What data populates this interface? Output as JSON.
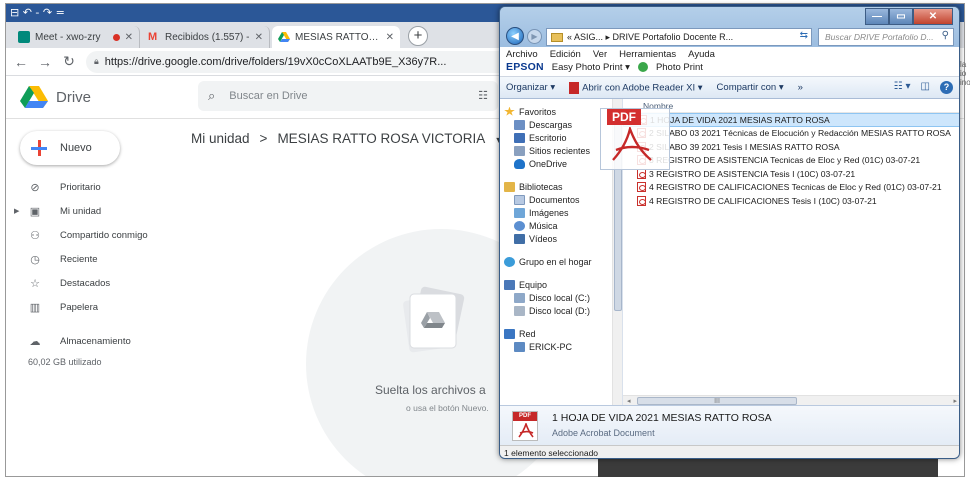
{
  "titlebar": {
    "quick_icons": "⊟ ↶ - ↷ ="
  },
  "browser": {
    "tabs": [
      {
        "label": "Meet - xwo-zry",
        "favicon_color": "#00897b"
      },
      {
        "label": "Recibidos (1.557) -",
        "favicon_color": "#ea4335"
      },
      {
        "label": "MESIAS RATTO ROS",
        "favicon_color": "#fbbc04"
      }
    ],
    "new_tab": "+",
    "url": "https://drive.google.com/drive/folders/19vX0cCoXLAATb9E_X36y7R..."
  },
  "drive": {
    "app_name": "Drive",
    "search_placeholder": "Buscar en Drive",
    "new_button": "Nuevo",
    "nav": [
      {
        "label": "Prioritario",
        "icon": "check-circle-icon"
      },
      {
        "label": "Mi unidad",
        "icon": "drive-icon"
      },
      {
        "label": "Compartido conmigo",
        "icon": "people-icon"
      },
      {
        "label": "Reciente",
        "icon": "clock-icon"
      },
      {
        "label": "Destacados",
        "icon": "star-icon"
      },
      {
        "label": "Papelera",
        "icon": "trash-icon"
      },
      {
        "label": "Almacenamiento",
        "icon": "cloud-icon"
      }
    ],
    "storage_used": "60,02 GB utilizado",
    "breadcrumb": {
      "root": "Mi unidad",
      "separator": ">",
      "current": "MESIAS RATTO ROSA VICTORIA",
      "dropdown": "▾"
    },
    "drop_title": "Suelta los archivos a",
    "drop_sub": "o usa el botón Nuevo."
  },
  "explorer": {
    "address": "« ASIG... ▸ DRIVE Portafolio Docente R...",
    "search_placeholder": "Buscar DRIVE Portafolio D...",
    "menu": [
      "Archivo",
      "Edición",
      "Ver",
      "Herramientas",
      "Ayuda"
    ],
    "epson": {
      "brand": "EPSON",
      "easy": "Easy Photo Print ▾",
      "photo": "Photo Print"
    },
    "commands": {
      "organize": "Organizar ▾",
      "open_with": "Abrir con Adobe Reader XI ▾",
      "share": "Compartir con ▾",
      "more": "»"
    },
    "nav_groups": [
      {
        "label": "Favoritos",
        "icon": "star-icon",
        "color": "#f2b632",
        "items": [
          {
            "label": "Descargas",
            "color": "#6b8fc4"
          },
          {
            "label": "Escritorio",
            "color": "#3f6fb6"
          },
          {
            "label": "Sitios recientes",
            "color": "#8aa0bf"
          },
          {
            "label": "OneDrive",
            "color": "#1e73c9"
          }
        ]
      },
      {
        "label": "Bibliotecas",
        "icon": "library-icon",
        "color": "#e3b548",
        "items": [
          {
            "label": "Documentos",
            "color": "#b7c9e2"
          },
          {
            "label": "Imágenes",
            "color": "#6fa6d8"
          },
          {
            "label": "Música",
            "color": "#5b8fd1"
          },
          {
            "label": "Vídeos",
            "color": "#406ea6"
          }
        ]
      },
      {
        "label": "Grupo en el hogar",
        "icon": "homegroup-icon",
        "color": "#3b9cd9",
        "items": []
      },
      {
        "label": "Equipo",
        "icon": "computer-icon",
        "color": "#4a78b8",
        "items": [
          {
            "label": "Disco local (C:)",
            "color": "#8ea8c8"
          },
          {
            "label": "Disco local (D:)",
            "color": "#a9b6c6"
          }
        ]
      },
      {
        "label": "Red",
        "icon": "network-icon",
        "color": "#3a76c2",
        "items": [
          {
            "label": "ERICK-PC",
            "color": "#5d8ac2"
          }
        ]
      }
    ],
    "column_header": "Nombre",
    "files": [
      "1 HOJA DE VIDA 2021 MESIAS RATTO ROSA",
      "2 SILABO 03 2021 Técnicas de Elocución y Redacción MESIAS RATTO ROSA",
      "2 SILABO 39 2021 Tesis I  MESIAS RATTO ROSA",
      "3 REGISTRO DE ASISTENCIA  Tecnicas de Eloc y Red (01C) 03-07-21",
      "3 REGISTRO DE ASISTENCIA  Tesis I  (10C) 03-07-21",
      "4 REGISTRO DE CALIFICACIONES  Tecnicas de Eloc y Red (01C) 03-07-21",
      "4 REGISTRO DE CALIFICACIONES  Tesis I  (10C) 03-07-21"
    ],
    "selected": {
      "name": "1 HOJA DE VIDA 2021 MESIAS RATTO ROSA",
      "type": "Adobe Acrobat Document",
      "badge": "PDF"
    },
    "status": "1 elemento seleccionado",
    "scroll_dots": "III"
  },
  "drag_ghost": {
    "label": "PDF"
  }
}
